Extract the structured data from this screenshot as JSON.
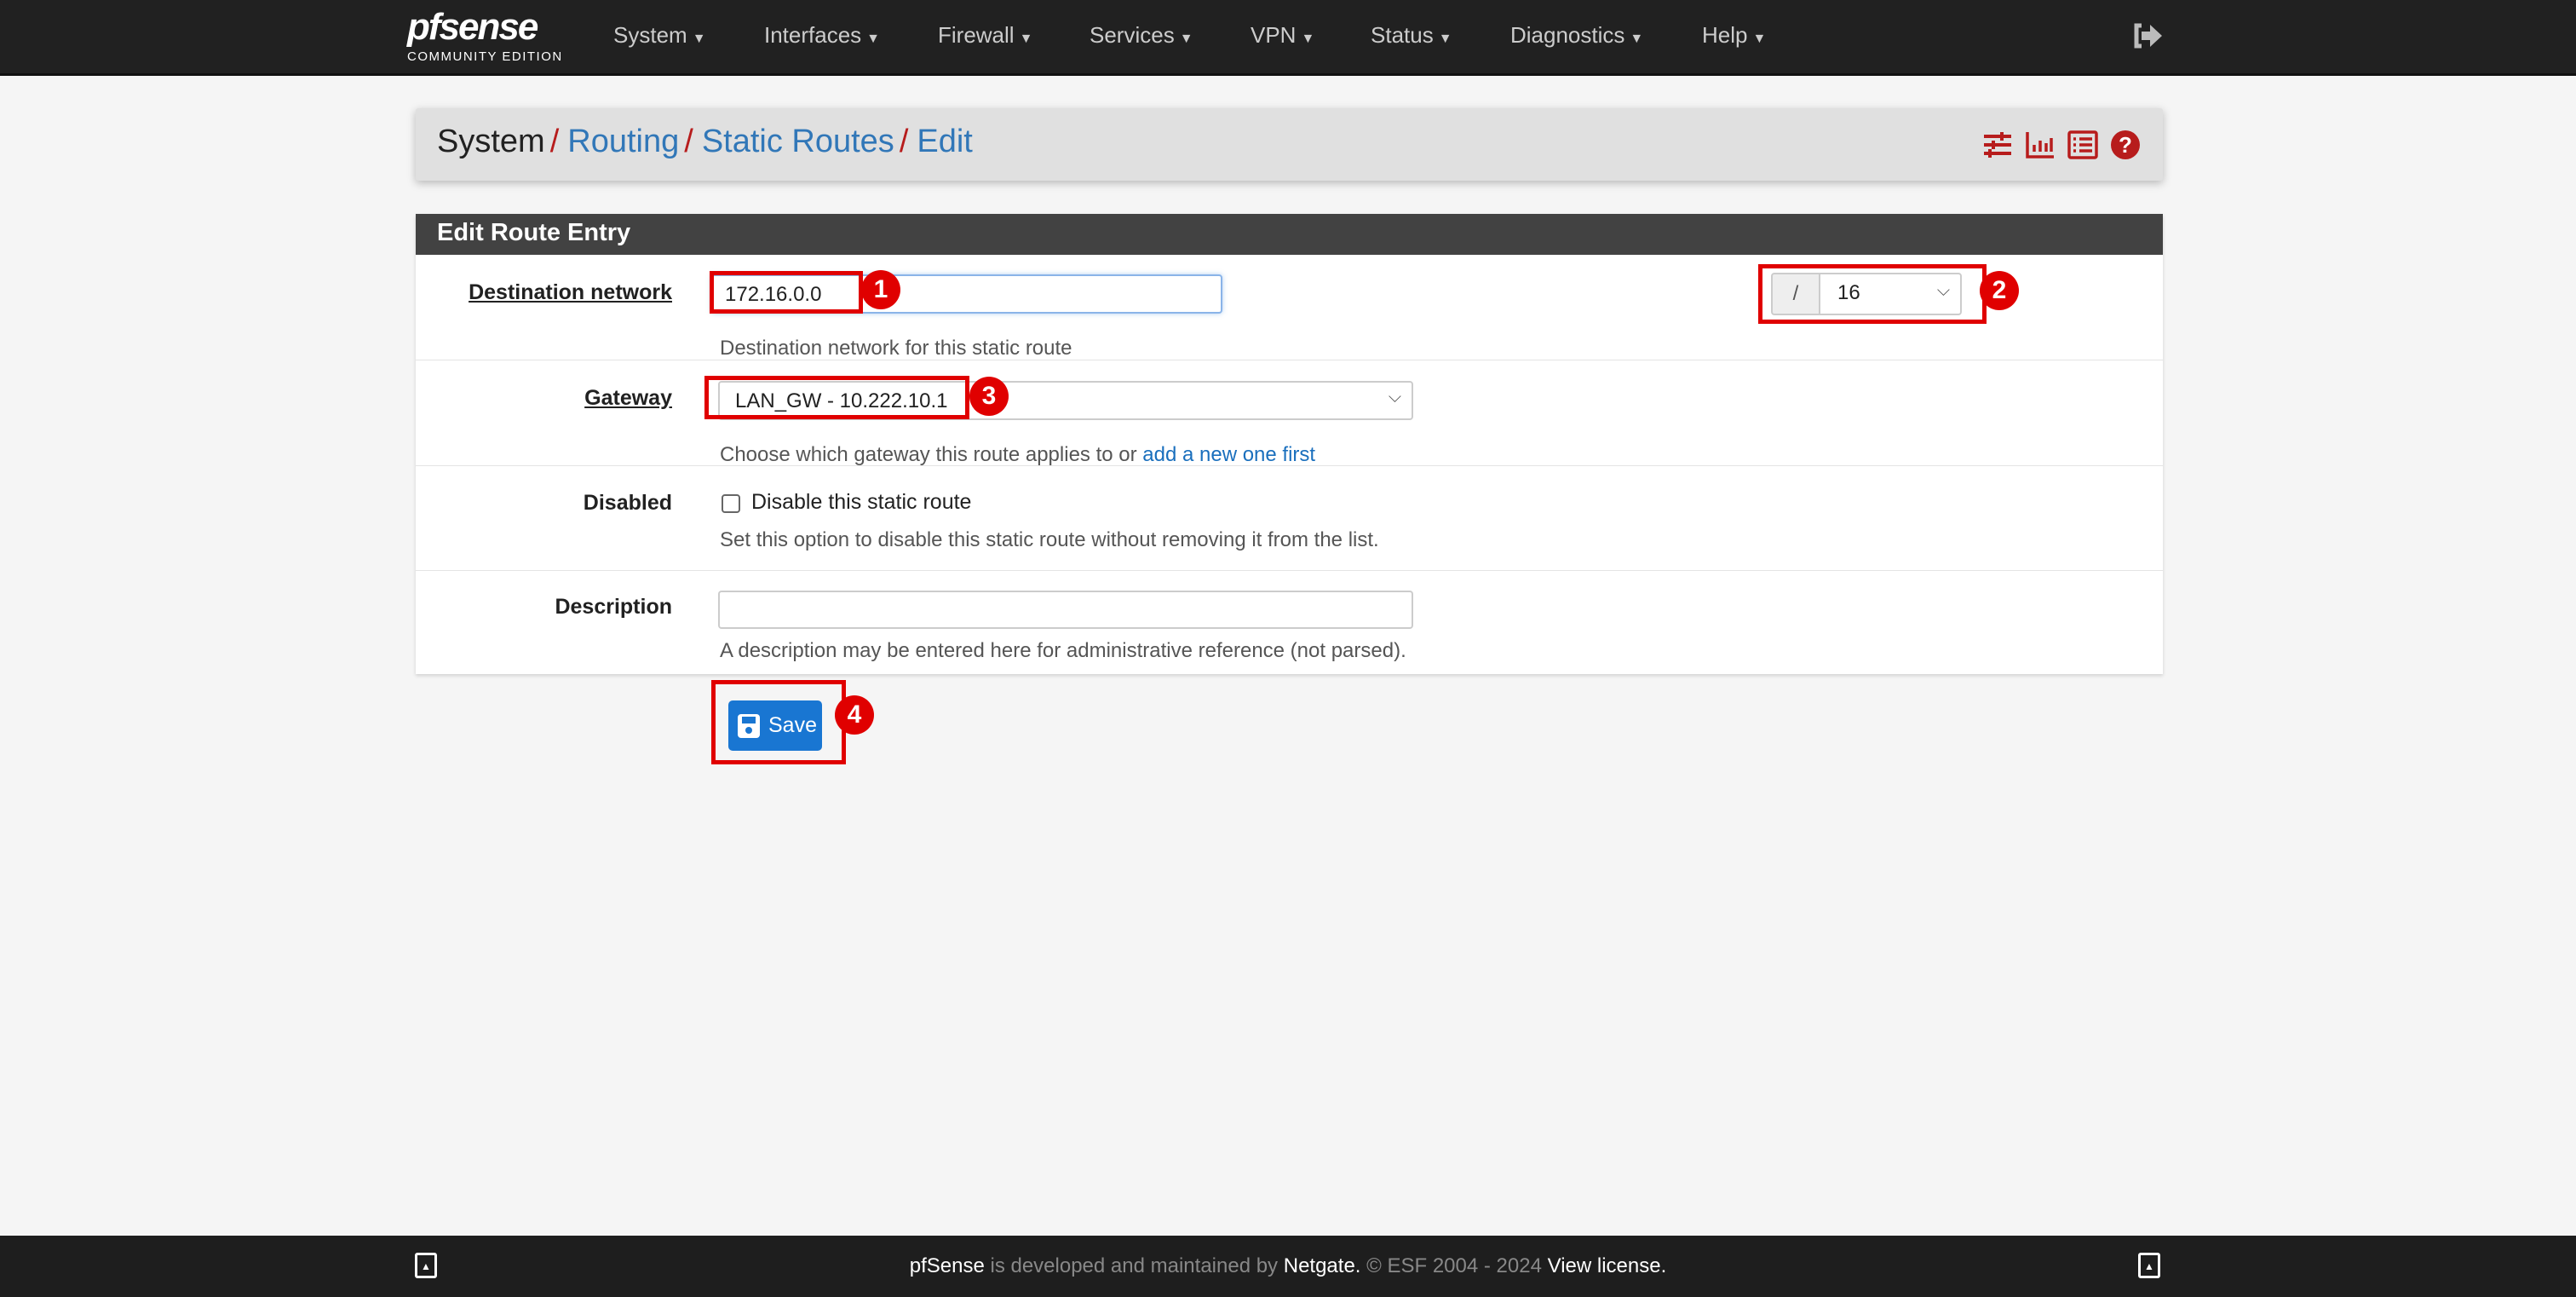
{
  "brand": {
    "logo_text": "pfsense",
    "edition": "COMMUNITY EDITION"
  },
  "nav": [
    "System",
    "Interfaces",
    "Firewall",
    "Services",
    "VPN",
    "Status",
    "Diagnostics",
    "Help"
  ],
  "breadcrumb": {
    "root": "System",
    "items": [
      "Routing",
      "Static Routes",
      "Edit"
    ]
  },
  "panel": {
    "title": "Edit Route Entry",
    "destination": {
      "label": "Destination network",
      "value": "172.16.0.0",
      "mask_prefix": "/",
      "mask": "16",
      "help": "Destination network for this static route"
    },
    "gateway": {
      "label": "Gateway",
      "value": "LAN_GW - 10.222.10.1",
      "help": "Choose which gateway this route applies to or",
      "help_link": "add a new one first"
    },
    "disabled": {
      "label": "Disabled",
      "checkbox_label": "Disable this static route",
      "checked": false,
      "help": "Set this option to disable this static route without removing it from the list."
    },
    "description": {
      "label": "Description",
      "value": "",
      "help": "A description may be entered here for administrative reference (not parsed)."
    }
  },
  "save_label": "Save",
  "annotations": [
    "1",
    "2",
    "3",
    "4"
  ],
  "footer": {
    "brand": "pfSense",
    "text1": "is developed and maintained by",
    "company": "Netgate.",
    "text2": "© ESF 2004 - 2024",
    "license": "View license."
  },
  "colors": {
    "accent": "#1976d2",
    "annotation": "#e00000",
    "navbar": "#212121"
  }
}
